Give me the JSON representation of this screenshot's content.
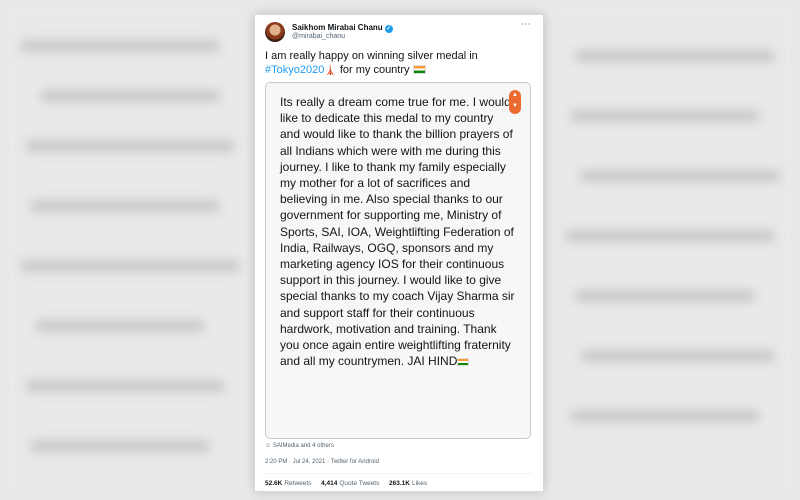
{
  "tweet": {
    "author_name": "Saikhom Mirabai Chanu",
    "handle": "@mirabai_chanu",
    "more_icon": "⋯",
    "text_line1": "I am really happy on winning silver medal in",
    "hashtag": "#Tokyo2020",
    "text_line2_rest": " for my country",
    "note": "Its really a dream come true for me. I would like to dedicate this medal to my country and would like to thank the billion prayers of all Indians which were with me during this journey. I like to thank my family especially my mother for a lot of sacrifices and believing in me. Also special thanks to our government for supporting me, Ministry of Sports, SAI, IOA, Weightlifting Federation of India, Railways, OGQ, sponsors and my marketing agency IOS for their continuous support in this journey. I would like to give special thanks to my coach Vijay Sharma sir and support staff for their continuous hardwork, motivation and training. Thank you once again entire weightlifting fraternity and all my countrymen. JAI HIND",
    "liked_by": "SAIMedia and 4 others",
    "timestamp": "2:20 PM · Jul 24, 2021 · Twitter for Android",
    "retweets_count": "52.6K",
    "retweets_label": "Retweets",
    "quotes_count": "4,414",
    "quotes_label": "Quote Tweets",
    "likes_count": "263.1K",
    "likes_label": "Likes"
  },
  "icons": {
    "verified": "verified-badge-icon",
    "tokyo_tower": "tokyo-tower-emoji",
    "india_flag": "india-flag-emoji",
    "scroll": "scroll-arrows-icon",
    "person": "person-icon"
  },
  "colors": {
    "link": "#1d9bf0",
    "note_background": "#f7f7f7",
    "scroll_button": "#ea6a2f"
  }
}
